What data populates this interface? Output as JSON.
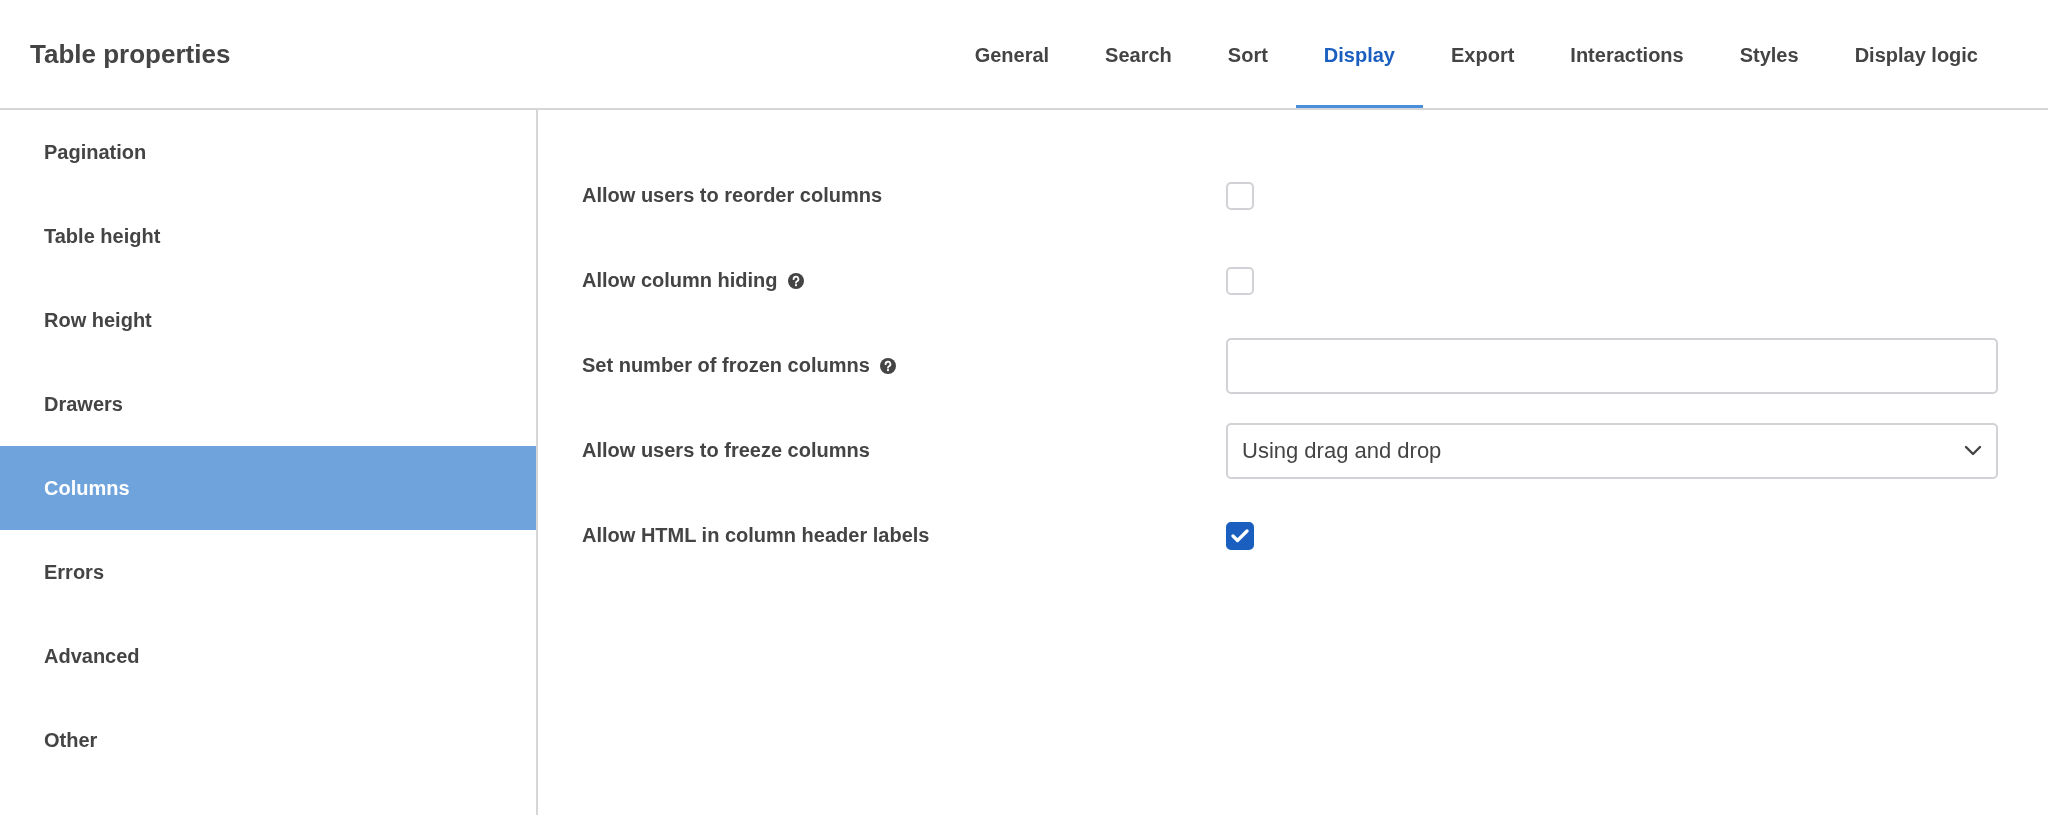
{
  "header": {
    "title": "Table properties"
  },
  "tabs": [
    {
      "label": "General",
      "selected": false
    },
    {
      "label": "Search",
      "selected": false
    },
    {
      "label": "Sort",
      "selected": false
    },
    {
      "label": "Display",
      "selected": true
    },
    {
      "label": "Export",
      "selected": false
    },
    {
      "label": "Interactions",
      "selected": false
    },
    {
      "label": "Styles",
      "selected": false
    },
    {
      "label": "Display logic",
      "selected": false
    }
  ],
  "sidebar": {
    "items": [
      {
        "label": "Pagination",
        "selected": false
      },
      {
        "label": "Table height",
        "selected": false
      },
      {
        "label": "Row height",
        "selected": false
      },
      {
        "label": "Drawers",
        "selected": false
      },
      {
        "label": "Columns",
        "selected": true
      },
      {
        "label": "Errors",
        "selected": false
      },
      {
        "label": "Advanced",
        "selected": false
      },
      {
        "label": "Other",
        "selected": false
      }
    ]
  },
  "settings": [
    {
      "kind": "checkbox",
      "label": "Allow users to reorder columns",
      "help": false,
      "checked": false
    },
    {
      "kind": "checkbox",
      "label": "Allow column hiding",
      "help": true,
      "checked": false
    },
    {
      "kind": "text",
      "label": "Set number of frozen columns",
      "help": true
    },
    {
      "kind": "select",
      "label": "Allow users to freeze columns",
      "help": false,
      "value": "Using drag and drop"
    },
    {
      "kind": "checkbox",
      "label": "Allow HTML in column header labels",
      "help": false,
      "checked": true
    }
  ]
}
